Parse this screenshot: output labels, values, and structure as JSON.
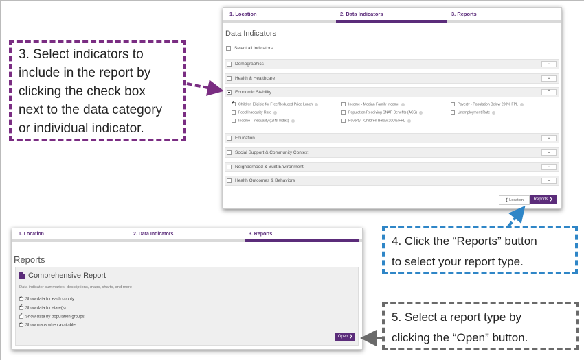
{
  "wizard_top": {
    "tabs": [
      "1. Location",
      "2. Data Indicators",
      "3. Reports"
    ],
    "title": "Data Indicators",
    "select_all": "Select all indicators",
    "categories": [
      "Demographics",
      "Health & Healthcare",
      "Economic Stability",
      "Education",
      "Social Support & Community Context",
      "Neighborhood & Built Environment",
      "Health Outcomes & Behaviors"
    ],
    "indicators": [
      "Children Eligible for Free/Reduced Price Lunch",
      "Income - Median Family Income",
      "Poverty - Population Below 200% FPL",
      "Food Insecurity Rate",
      "Population Receiving SNAP Benefits (ACS)",
      "Unemployment Rate",
      "Income - Inequality (GINI Index)",
      "Poverty - Children Below 200% FPL"
    ],
    "back_button": "Location",
    "next_button": "Reports",
    "chevron_glyph": "⌄",
    "chevron_up_glyph": "⌃"
  },
  "wizard_bottom": {
    "tabs": [
      "1. Location",
      "2. Data Indicators",
      "3. Reports"
    ],
    "title": "Reports",
    "report_title": "Comprehensive Report",
    "report_desc": "Data indicator summaries, descriptions, maps, charts, and more",
    "options": [
      "Show data for each county",
      "Show data for state(s)",
      "Show data by population groups",
      "Show maps when available"
    ],
    "open_button": "Open"
  },
  "callouts": {
    "step3": [
      "3. Select indicators to",
      "include in the report by",
      "clicking the check box",
      "next to the data category",
      "or individual indicator."
    ],
    "step4": [
      "4. Click the “Reports” button",
      "to select your report type."
    ],
    "step5": [
      "5. Select a report type by",
      "clicking the “Open” button."
    ]
  },
  "colors": {
    "accent_purple": "#5b2c7a",
    "callout_purple": "#7a2d82",
    "callout_blue": "#2f86c7",
    "callout_gray": "#6a6a6a"
  }
}
